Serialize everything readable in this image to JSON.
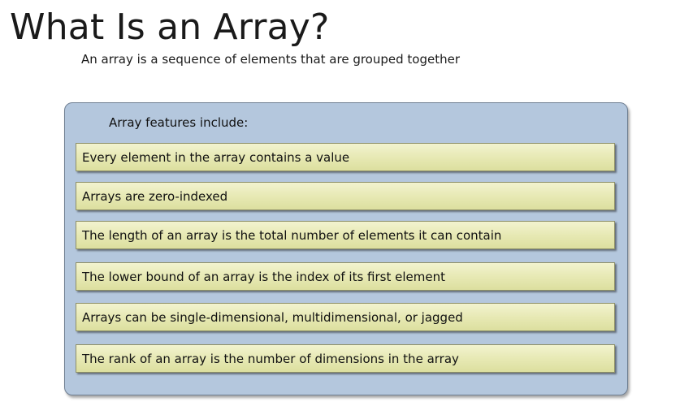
{
  "slide": {
    "title": "What Is an Array?",
    "subtitle": "An array is a sequence of elements that are grouped together"
  },
  "panel": {
    "heading": "Array features include:",
    "features": [
      "Every element in the array contains a value",
      "Arrays are zero-indexed",
      "The length of an array is the total number of elements it can contain",
      "The lower bound of an array is the index of its first element",
      "Arrays can be single-dimensional, multidimensional, or jagged",
      "The rank of an array is the number of dimensions in the array"
    ]
  },
  "colors": {
    "panel_background": "#b4c7dd",
    "feature_background": "#e6e8b2"
  }
}
